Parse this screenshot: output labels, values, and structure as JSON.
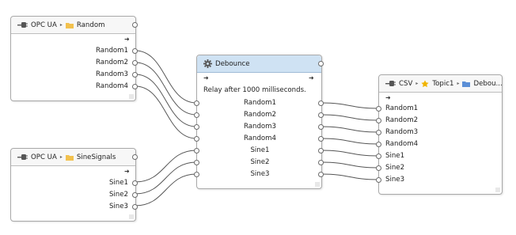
{
  "nodes": {
    "opc_random": {
      "header": {
        "source": "OPC UA",
        "folder": "Random"
      },
      "outputs": [
        "Random1",
        "Random2",
        "Random3",
        "Random4"
      ]
    },
    "opc_sine": {
      "header": {
        "source": "OPC UA",
        "folder": "SineSignals"
      },
      "outputs": [
        "Sine1",
        "Sine2",
        "Sine3"
      ]
    },
    "debounce": {
      "header": {
        "title": "Debounce"
      },
      "description": "Relay after 1000 milliseconds.",
      "ports": [
        "Random1",
        "Random2",
        "Random3",
        "Random4",
        "Sine1",
        "Sine2",
        "Sine3"
      ]
    },
    "csv": {
      "header": {
        "source": "CSV",
        "topic": "Topic1",
        "folder": "Debou..."
      },
      "inputs": [
        "Random1",
        "Random2",
        "Random3",
        "Random4",
        "Sine1",
        "Sine2",
        "Sine3"
      ]
    }
  },
  "colors": {
    "node_border": "#a9a9a9",
    "debounce_header": "#cfe2f3",
    "wire": "#555555",
    "folder_icon": "#f2c14e",
    "star_icon": "#f0b400"
  }
}
